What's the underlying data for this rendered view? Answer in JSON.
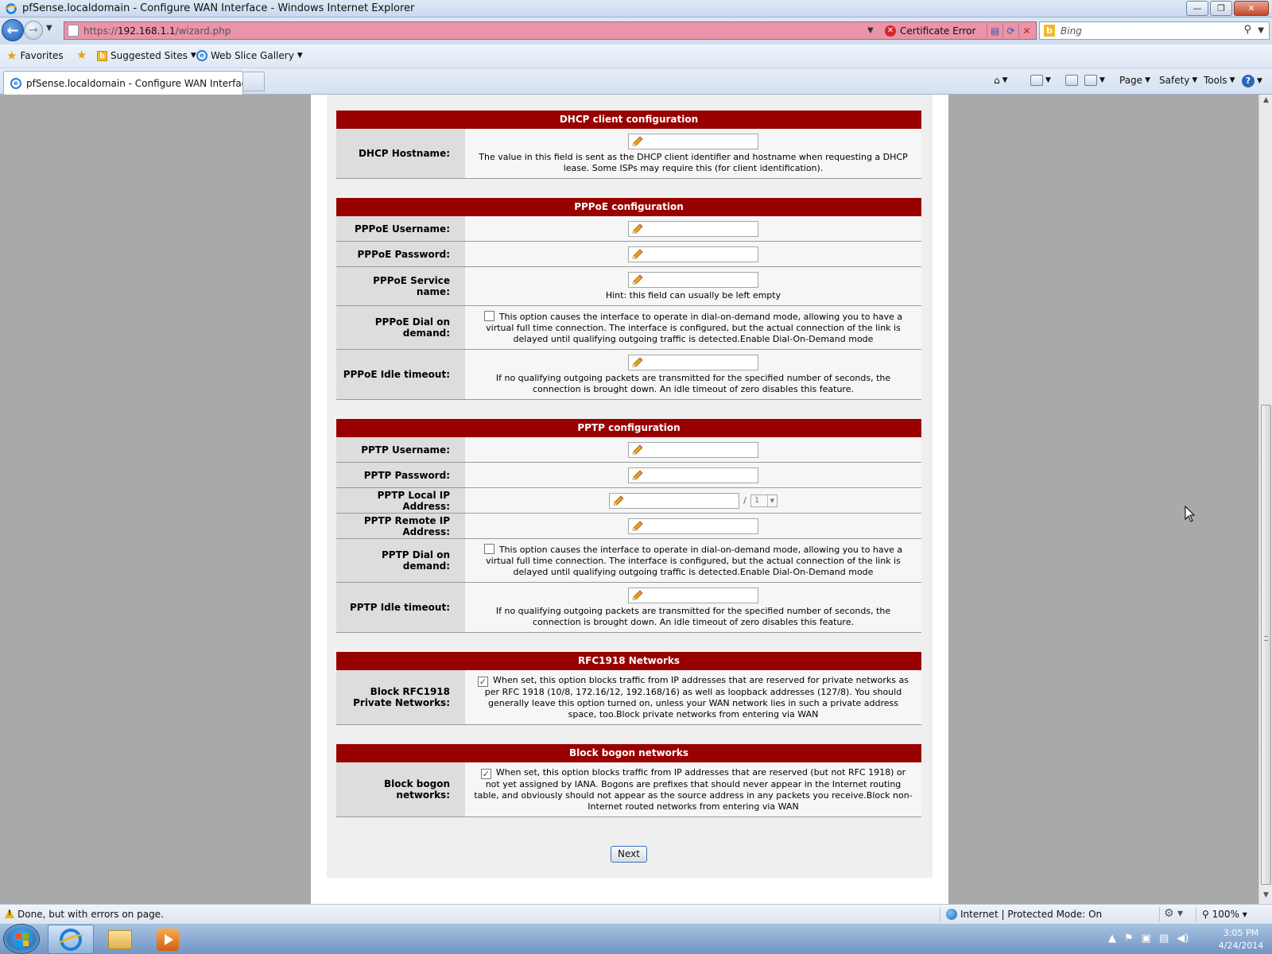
{
  "window": {
    "title": "pfSense.localdomain - Configure WAN Interface - Windows Internet Explorer",
    "minimize": "—",
    "restore": "❐",
    "close": "✕"
  },
  "address_bar": {
    "url_prefix": "https://",
    "url_host": "192.168.1.1",
    "url_path": "/wizard.php",
    "certificate_error": "Certificate Error"
  },
  "search": {
    "placeholder": "Bing"
  },
  "favorites_bar": {
    "favorites": "Favorites",
    "suggested_sites": "Suggested Sites",
    "web_slice_gallery": "Web Slice Gallery"
  },
  "tabs": [
    {
      "label": "pfSense.localdomain - Configure WAN Interface",
      "active": true
    }
  ],
  "command_bar": {
    "page": "Page",
    "safety": "Safety",
    "tools": "Tools",
    "help": "?"
  },
  "form": {
    "sections": [
      {
        "title": "DHCP client configuration",
        "rows": [
          {
            "label": "DHCP Hostname:",
            "type": "text",
            "value": "",
            "description": "The value in this field is sent as the DHCP client identifier and hostname when requesting a DHCP lease. Some ISPs may require this (for client identification)."
          }
        ]
      },
      {
        "title": "PPPoE configuration",
        "rows": [
          {
            "label": "PPPoE Username:",
            "type": "text",
            "value": ""
          },
          {
            "label": "PPPoE Password:",
            "type": "text",
            "value": ""
          },
          {
            "label": "PPPoE Service name:",
            "type": "text",
            "value": "",
            "description": "Hint: this field can usually be left empty"
          },
          {
            "label": "PPPoE Dial on demand:",
            "type": "checkbox",
            "checked": false,
            "description": "This option causes the interface to operate in dial-on-demand mode, allowing you to have a virtual full time connection. The interface is configured, but the actual connection of the link is delayed until qualifying outgoing traffic is detected.Enable Dial-On-Demand mode"
          },
          {
            "label": "PPPoE Idle timeout:",
            "type": "text",
            "value": "",
            "description": "If no qualifying outgoing packets are transmitted for the specified number of seconds, the connection is brought down. An idle timeout of zero disables this feature."
          }
        ]
      },
      {
        "title": "PPTP configuration",
        "rows": [
          {
            "label": "PPTP Username:",
            "type": "text",
            "value": ""
          },
          {
            "label": "PPTP Password:",
            "type": "text",
            "value": ""
          },
          {
            "label": "PPTP Local IP Address:",
            "type": "ip",
            "value": "",
            "subnet": "1"
          },
          {
            "label": "PPTP Remote IP Address:",
            "type": "text",
            "value": ""
          },
          {
            "label": "PPTP Dial on demand:",
            "type": "checkbox",
            "checked": false,
            "description": "This option causes the interface to operate in dial-on-demand mode, allowing you to have a virtual full time connection. The interface is configured, but the actual connection of the link is delayed until qualifying outgoing traffic is detected.Enable Dial-On-Demand mode"
          },
          {
            "label": "PPTP Idle timeout:",
            "type": "text",
            "value": "",
            "description": "If no qualifying outgoing packets are transmitted for the specified number of seconds, the connection is brought down. An idle timeout of zero disables this feature."
          }
        ]
      },
      {
        "title": "RFC1918 Networks",
        "rows": [
          {
            "label": "Block RFC1918 Private Networks:",
            "type": "checkbox",
            "checked": true,
            "description": "When set, this option blocks traffic from IP addresses that are reserved for private networks as per RFC 1918 (10/8, 172.16/12, 192.168/16) as well as loopback addresses (127/8). You should generally leave this option turned on, unless your WAN network lies in such a private address space, too.Block private networks from entering via WAN"
          }
        ]
      },
      {
        "title": "Block bogon networks",
        "rows": [
          {
            "label": "Block bogon networks:",
            "type": "checkbox",
            "checked": true,
            "description": "When set, this option blocks traffic from IP addresses that are reserved (but not RFC 1918) or not yet assigned by IANA. Bogons are prefixes that should never appear in the Internet routing table, and obviously should not appear as the source address in any packets you receive.Block non-Internet routed networks from entering via WAN"
          }
        ]
      }
    ],
    "next_label": "Next"
  },
  "status_bar": {
    "status": "Done, but with errors on page.",
    "zone": "Internet | Protected Mode: On",
    "zoom": "100%"
  },
  "taskbar": {
    "time": "3:05 PM",
    "date": "4/24/2014"
  },
  "colors": {
    "section_header": "#990000",
    "page_background": "#a9a9a9",
    "address_error": "#e994a9"
  }
}
